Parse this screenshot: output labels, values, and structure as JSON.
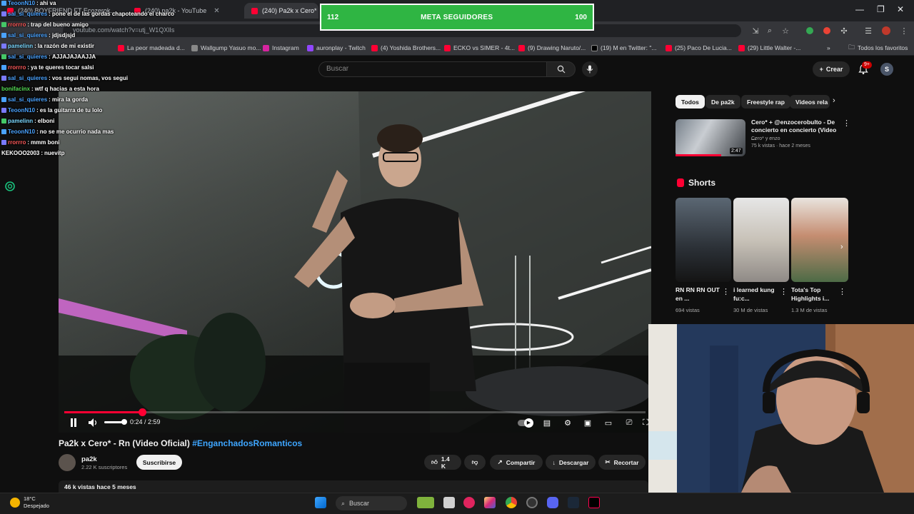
{
  "browser": {
    "tabs": [
      {
        "label": "(240) BOYFRIEND FT Ecozerok..."
      },
      {
        "label": "(240) pa2k - YouTube"
      },
      {
        "label": "(240) Pa2k x Cero* - Rn"
      }
    ],
    "url": "youtube.com/watch?v=utj_W1QXlIs",
    "bookmarks": [
      {
        "label": "La peor madeada d..."
      },
      {
        "label": "Wallgump Yasuo mo..."
      },
      {
        "label": "Instagram"
      },
      {
        "label": "auronplay - Twitch"
      },
      {
        "label": "(4) Yoshida Brothers..."
      },
      {
        "label": "ECKO vs SIMER - 4t..."
      },
      {
        "label": "(9) Drawing Naruto/..."
      },
      {
        "label": "(19) M en Twitter: \"..."
      },
      {
        "label": "(25) Paco De Lucia..."
      },
      {
        "label": "(29) Little Walter -..."
      }
    ],
    "all_bookmarks": "Todos los favoritos"
  },
  "overlay": {
    "goal": {
      "current": "112",
      "label": "META SEGUIDORES",
      "target": "100"
    },
    "chat": [
      {
        "user": "TeoonN10",
        "msg": "ahi va",
        "color": "#4aa3ff"
      },
      {
        "user": "sal_si_quieres",
        "msg": "pone el de las gordas chapoteando el charco",
        "color": "#4aa3ff"
      },
      {
        "user": "rrorrro",
        "msg": "trap del bueno amigo",
        "color": "#ff5a5a"
      },
      {
        "user": "sal_si_quieres",
        "msg": "jdjsdjsjd",
        "color": "#4aa3ff"
      },
      {
        "user": "pamelinn",
        "msg": "la razón de mi existir",
        "color": "#7ad7ff"
      },
      {
        "user": "sal_si_quieres",
        "msg": "AJJAJAJAAJJA",
        "color": "#4aa3ff"
      },
      {
        "user": "rrorrro",
        "msg": "ya te queres tocar salsi",
        "color": "#ff5a5a"
      },
      {
        "user": "sal_si_quieres",
        "msg": "vos segui nomas, vos segui",
        "color": "#4aa3ff"
      },
      {
        "user": "bonifacinx",
        "msg": "wtf q hacias a esta hora",
        "color": "#55dd55"
      },
      {
        "user": "sal_si_quieres",
        "msg": "mira la gorda",
        "color": "#4aa3ff"
      },
      {
        "user": "TeoonN10",
        "msg": "es la guitarra de tu lolo",
        "color": "#4aa3ff"
      },
      {
        "user": "pamelinn",
        "msg": "elboni",
        "color": "#7ad7ff"
      },
      {
        "user": "TeoonN10",
        "msg": "no se me ocurrio nada mas",
        "color": "#4aa3ff"
      },
      {
        "user": "rrorrro",
        "msg": "mmm boni",
        "color": "#ff5a5a"
      },
      {
        "user": "KEKOOO2003",
        "msg": "nuevitp",
        "color": "#ffffff"
      }
    ]
  },
  "youtube": {
    "search_placeholder": "Buscar",
    "create_label": "Crear",
    "notifications": "9+",
    "avatar_letter": "S",
    "player": {
      "time": "0:24 / 2:59",
      "progress": 0.134
    },
    "video": {
      "title": "Pa2k x Cero* - Rn (Video Oficial)",
      "hashtag": "#EnganchadosRomanticos",
      "channel": "pa2k",
      "subscribers": "2.22 K suscriptores",
      "subscribe": "Suscribirse",
      "likes": "1.4 K",
      "share": "Compartir",
      "download": "Descargar",
      "clip": "Recortar",
      "views_date": "46 k vistas  hace 5 meses"
    },
    "chips": [
      "Todos",
      "De pa2k",
      "Freestyle rap",
      "Videos rela"
    ],
    "recommended": {
      "title": "Cero* + @enzocerobulto - De concierto en concierto (Video ...",
      "channel": "Cero* y enzo",
      "meta": "75 k vistas · hace 2 meses",
      "duration": "2:47"
    },
    "shorts_label": "Shorts",
    "shorts": [
      {
        "title": "RN RN RN OUT en ...",
        "views": "694 vistas"
      },
      {
        "title": "i learned kung fu:c...",
        "views": "30 M de vistas"
      },
      {
        "title": "Tota's Top Highlights i...",
        "views": "1.3 M de vistas"
      }
    ]
  },
  "taskbar": {
    "temp": "18°C",
    "weather": "Despejado",
    "search": "Buscar"
  }
}
